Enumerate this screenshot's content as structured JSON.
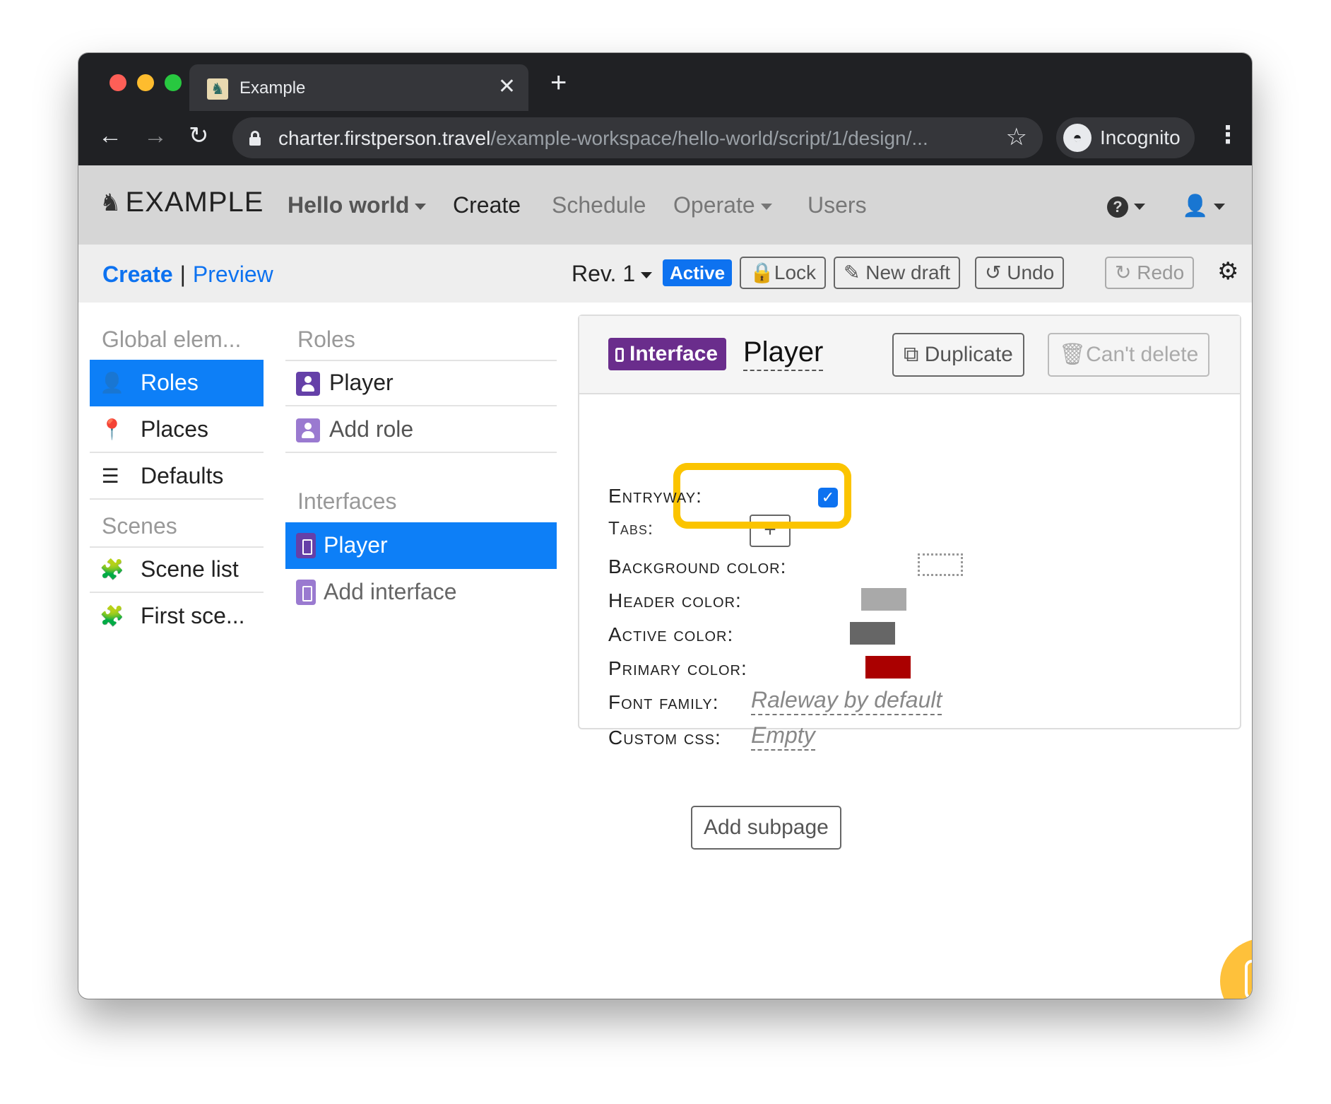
{
  "browser": {
    "tab_title": "Example",
    "tab_close": "✕",
    "new_tab": "+",
    "url_host": "charter.firstperson.travel",
    "url_path": "/example-workspace/hello-world/script/1/design/...",
    "incognito_label": "Incognito",
    "icons": [
      "back-arrow-icon",
      "forward-arrow-icon",
      "reload-icon",
      "lock-icon",
      "star-icon",
      "incognito-icon",
      "menu-dots-icon"
    ]
  },
  "navbar": {
    "brand": "EXAMPLE",
    "project": "Hello world",
    "items": {
      "create": "Create",
      "schedule": "Schedule",
      "operate": "Operate",
      "users": "Users"
    }
  },
  "subbar": {
    "create": "Create",
    "separator": "|",
    "preview": "Preview",
    "revision": "Rev. 1",
    "status_badge": "Active",
    "lock": "Lock",
    "new_draft": "New draft",
    "undo": "Undo",
    "redo": "Redo"
  },
  "sidebar": {
    "global_heading": "Global elem...",
    "roles": "Roles",
    "places": "Places",
    "defaults": "Defaults",
    "scenes_heading": "Scenes",
    "scene_list": "Scene list",
    "first_scene": "First sce..."
  },
  "middle": {
    "roles_heading": "Roles",
    "role_player": "Player",
    "add_role": "Add role",
    "interfaces_heading": "Interfaces",
    "interface_player": "Player",
    "add_interface": "Add interface"
  },
  "card": {
    "badge": "Interface",
    "title": "Player",
    "duplicate": "Duplicate",
    "cant_delete": "Can't delete",
    "fields": {
      "entryway": "Entryway:",
      "entryway_checked": true,
      "tabs": "Tabs:",
      "tabs_add": "+",
      "background_color": "Background color:",
      "header_color": "Header color:",
      "active_color": "Active color:",
      "primary_color": "Primary color:",
      "font_family": "Font family:",
      "font_family_value": "Raleway by default",
      "custom_css": "Custom css:",
      "custom_css_value": "Empty"
    },
    "colors": {
      "header": "#a9a9a9",
      "active": "#666666",
      "primary": "#aa0000"
    }
  },
  "add_subpage": "Add subpage",
  "accent_color": "#0d7ff7",
  "highlight_color": "#fbc400"
}
